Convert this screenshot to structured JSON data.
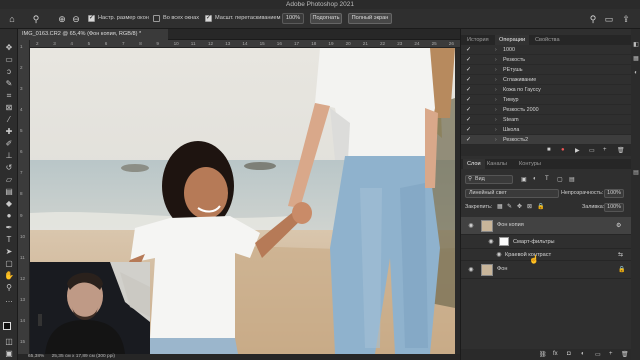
{
  "app": {
    "title": "Adobe Photoshop 2021"
  },
  "options_bar": {
    "zoom_value": "100%",
    "cb_resize_windows": "Настр. размер окон",
    "cb_all_windows": "Во всех окнах",
    "cb_scrubby_zoom": "Масшт. перетаскиванием",
    "fit_button": "Подогнать",
    "fill_button": "Полный экран"
  },
  "document": {
    "tab_title": "IMG_0163.CR2 @ 65,4% (Фон копия, RGB/8) *",
    "status": "65,38%",
    "status_extra": "25,35 см x 17,89 см (300 ppi)"
  },
  "ruler": {
    "top_ticks": [
      "2",
      "3",
      "4",
      "5",
      "6",
      "7",
      "8",
      "9",
      "10",
      "11",
      "12",
      "13",
      "14",
      "15",
      "16",
      "17",
      "18",
      "19",
      "20",
      "21",
      "22",
      "23",
      "24",
      "25",
      "26"
    ],
    "left_ticks": [
      "1",
      "2",
      "3",
      "4",
      "5",
      "6",
      "7",
      "8",
      "9",
      "10",
      "11",
      "12",
      "13",
      "14",
      "15"
    ]
  },
  "history_panel": {
    "tabs": [
      "История",
      "Операции",
      "Свойства"
    ],
    "active_tab": "Операции",
    "rows": [
      {
        "label": "1000",
        "checked": true,
        "selected": false
      },
      {
        "label": "Резкость",
        "checked": true,
        "selected": false
      },
      {
        "label": "РЕтушь",
        "checked": true,
        "selected": false
      },
      {
        "label": "Сглаживание",
        "checked": true,
        "selected": false
      },
      {
        "label": "Кожа по Гауссу",
        "checked": true,
        "selected": false
      },
      {
        "label": "Тимур",
        "checked": true,
        "selected": false
      },
      {
        "label": "Резкость 2000",
        "checked": true,
        "selected": false
      },
      {
        "label": "Steam",
        "checked": true,
        "selected": false
      },
      {
        "label": "Школа",
        "checked": true,
        "selected": false
      },
      {
        "label": "Резкость2",
        "checked": true,
        "selected": true
      }
    ]
  },
  "layers_panel": {
    "tabs": [
      "Слои",
      "Каналы",
      "Контуры"
    ],
    "active_tab": "Слои",
    "filter_kind": "Вид",
    "blend_mode": "Линейный свет",
    "opacity_label": "Непрозрачность:",
    "opacity_value": "100%",
    "lock_label": "Закрепить:",
    "fill_label": "Заливка:",
    "fill_value": "100%",
    "layers": [
      {
        "name": "Фон копия",
        "type": "smart"
      },
      {
        "name": "Смарт-фильтры",
        "type": "filters"
      },
      {
        "name": "Краевой контраст",
        "type": "filter"
      },
      {
        "name": "Фон",
        "type": "background"
      }
    ]
  },
  "colors": {
    "accent": "#2d8ceb",
    "panel_bg": "#2f2f2f",
    "canvas_bg": "#1e1e1e"
  }
}
